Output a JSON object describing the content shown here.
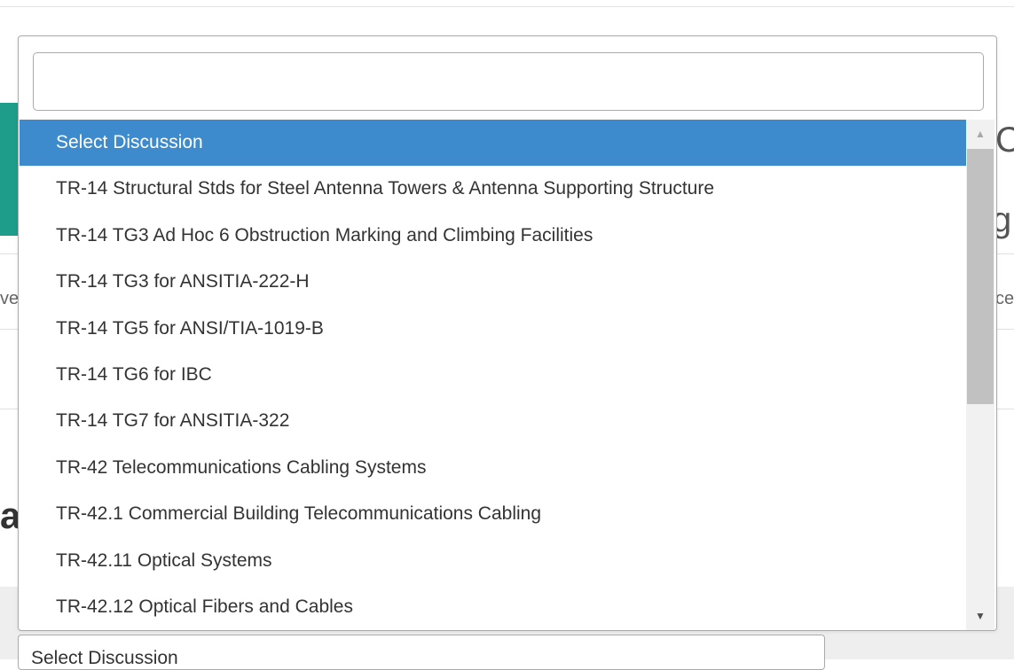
{
  "background": {
    "glyph_c": "C",
    "glyph_g": "g",
    "glyph_ce": "ce",
    "glyph_ve": "ve",
    "glyph_a": "a",
    "select_value": "Select Discussion"
  },
  "dropdown": {
    "search_value": "",
    "options": [
      "Select Discussion",
      "TR-14 Structural Stds for Steel Antenna Towers & Antenna Supporting Structure",
      "TR-14 TG3 Ad Hoc 6 Obstruction Marking and Climbing Facilities",
      "TR-14 TG3 for ANSITIA-222-H",
      "TR-14 TG5 for ANSI/TIA-1019-B",
      "TR-14 TG6 for IBC",
      "TR-14 TG7 for ANSITIA-322",
      "TR-42 Telecommunications Cabling Systems",
      "TR-42.1 Commercial Building Telecommunications Cabling",
      "TR-42.11 Optical Systems",
      "TR-42.12 Optical Fibers and Cables"
    ],
    "highlighted_index": 0,
    "scroll_up_icon": "▲",
    "scroll_down_icon": "▼"
  },
  "colors": {
    "highlight": "#3d8bcd",
    "logo_green": "#1e9d8b"
  }
}
